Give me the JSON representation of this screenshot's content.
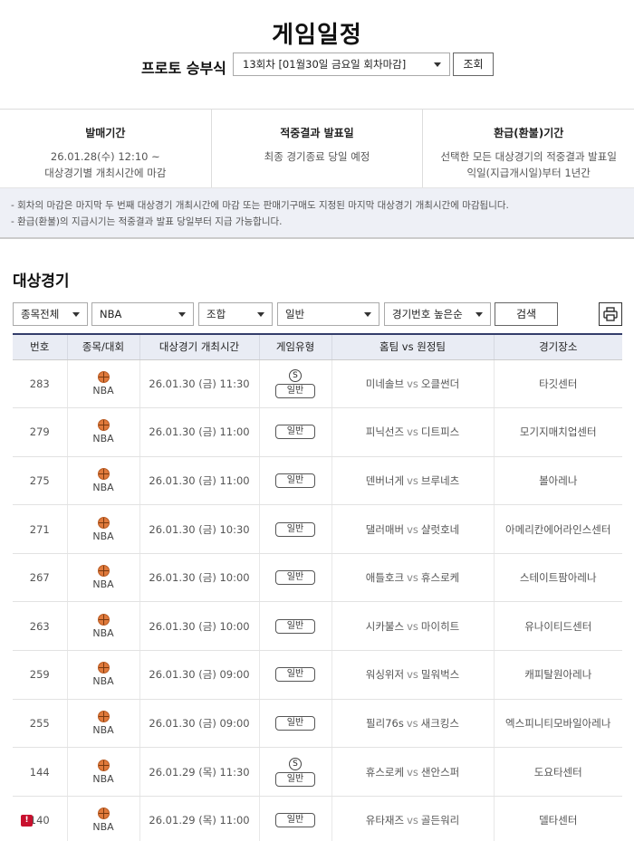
{
  "page_title": "게임일정",
  "round": {
    "label": "프로토 승부식",
    "selected": "13회차 [01월30일 금요일 회차마감]",
    "query_button": "조회"
  },
  "info": [
    {
      "heading": "발매기간",
      "lines": [
        "26.01.28(수) 12:10 ~",
        "대상경기별 개최시간에 마감"
      ]
    },
    {
      "heading": "적중결과 발표일",
      "lines": [
        "최종 경기종료 당일 예정",
        ""
      ]
    },
    {
      "heading": "환급(환불)기간",
      "lines": [
        "선택한 모든 대상경기의 적중결과 발표일",
        "익일(지급개시일)부터 1년간"
      ]
    }
  ],
  "notices": [
    "- 회차의 마감은 마지막 두 번째 대상경기 개최시간에 마감 또는 판매기구매도 지정된 마지막 대상경기 개최시간에 마감됩니다.",
    "- 환급(환불)의 지급시기는 적중결과 발표 당일부터 지급 가능합니다."
  ],
  "section_title": "대상경기",
  "filters": {
    "sport": "종목전체",
    "league": "NBA",
    "bet_type": "조합",
    "game_type": "일반",
    "sort": "경기번호 높은순",
    "search_button": "검색"
  },
  "table": {
    "headers": [
      "번호",
      "종목/대회",
      "대상경기 개최시간",
      "게임유형",
      "홈팀 vs 원정팀",
      "경기장소"
    ],
    "vs_label": "vs",
    "s_label": "S",
    "rows": [
      {
        "no": "283",
        "alert": false,
        "league": "NBA",
        "time": "26.01.30 (금) 11:30",
        "special": true,
        "type": "일반",
        "home": "미네솔브",
        "away": "오클썬더",
        "venue": "타깃센터"
      },
      {
        "no": "279",
        "alert": false,
        "league": "NBA",
        "time": "26.01.30 (금) 11:00",
        "special": false,
        "type": "일반",
        "home": "피닉선즈",
        "away": "디트피스",
        "venue": "모기지매치업센터"
      },
      {
        "no": "275",
        "alert": false,
        "league": "NBA",
        "time": "26.01.30 (금) 11:00",
        "special": false,
        "type": "일반",
        "home": "덴버너게",
        "away": "브루네츠",
        "venue": "볼아레나"
      },
      {
        "no": "271",
        "alert": false,
        "league": "NBA",
        "time": "26.01.30 (금) 10:30",
        "special": false,
        "type": "일반",
        "home": "댈러매버",
        "away": "샬럿호네",
        "venue": "아메리칸에어라인스센터"
      },
      {
        "no": "267",
        "alert": false,
        "league": "NBA",
        "time": "26.01.30 (금) 10:00",
        "special": false,
        "type": "일반",
        "home": "애틀호크",
        "away": "휴스로케",
        "venue": "스테이트팜아레나"
      },
      {
        "no": "263",
        "alert": false,
        "league": "NBA",
        "time": "26.01.30 (금) 10:00",
        "special": false,
        "type": "일반",
        "home": "시카불스",
        "away": "마이히트",
        "venue": "유나이티드센터"
      },
      {
        "no": "259",
        "alert": false,
        "league": "NBA",
        "time": "26.01.30 (금) 09:00",
        "special": false,
        "type": "일반",
        "home": "워싱위저",
        "away": "밀워벅스",
        "venue": "캐피탈원아레나"
      },
      {
        "no": "255",
        "alert": false,
        "league": "NBA",
        "time": "26.01.30 (금) 09:00",
        "special": false,
        "type": "일반",
        "home": "필리76s",
        "away": "새크킹스",
        "venue": "엑스피니티모바일아레나"
      },
      {
        "no": "144",
        "alert": false,
        "league": "NBA",
        "time": "26.01.29 (목) 11:30",
        "special": true,
        "type": "일반",
        "home": "휴스로케",
        "away": "샌안스퍼",
        "venue": "도요타센터"
      },
      {
        "no": "140",
        "alert": true,
        "league": "NBA",
        "time": "26.01.29 (목) 11:00",
        "special": false,
        "type": "일반",
        "home": "유타재즈",
        "away": "골든워리",
        "venue": "델타센터"
      }
    ]
  }
}
